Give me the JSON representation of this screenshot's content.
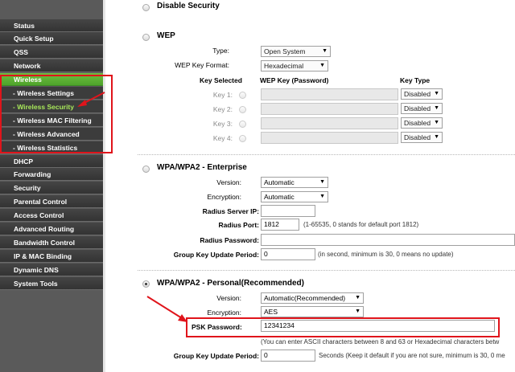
{
  "sidebar": {
    "items": [
      {
        "label": "Status"
      },
      {
        "label": "Quick Setup"
      },
      {
        "label": "QSS"
      },
      {
        "label": "Network"
      },
      {
        "label": "Wireless"
      },
      {
        "label": "- Wireless Settings"
      },
      {
        "label": "- Wireless Security"
      },
      {
        "label": "- Wireless MAC Filtering"
      },
      {
        "label": "- Wireless Advanced"
      },
      {
        "label": "- Wireless Statistics"
      },
      {
        "label": "DHCP"
      },
      {
        "label": "Forwarding"
      },
      {
        "label": "Security"
      },
      {
        "label": "Parental Control"
      },
      {
        "label": "Access Control"
      },
      {
        "label": "Advanced Routing"
      },
      {
        "label": "Bandwidth Control"
      },
      {
        "label": "IP & MAC Binding"
      },
      {
        "label": "Dynamic DNS"
      },
      {
        "label": "System Tools"
      }
    ]
  },
  "disable_security": {
    "label": "Disable Security"
  },
  "wep": {
    "title": "WEP",
    "type_label": "Type:",
    "type_value": "Open System",
    "format_label": "WEP Key Format:",
    "format_value": "Hexadecimal",
    "col_selected": "Key Selected",
    "col_key": "WEP Key (Password)",
    "col_type": "Key Type",
    "keys": [
      {
        "label": "Key 1:",
        "type": "Disabled"
      },
      {
        "label": "Key 2:",
        "type": "Disabled"
      },
      {
        "label": "Key 3:",
        "type": "Disabled"
      },
      {
        "label": "Key 4:",
        "type": "Disabled"
      }
    ]
  },
  "enterprise": {
    "title": "WPA/WPA2 - Enterprise",
    "version_label": "Version:",
    "version_value": "Automatic",
    "encryption_label": "Encryption:",
    "encryption_value": "Automatic",
    "radius_ip_label": "Radius Server IP:",
    "radius_ip_value": "",
    "radius_port_label": "Radius Port:",
    "radius_port_value": "1812",
    "radius_port_hint": "(1-65535, 0 stands for default port 1812)",
    "radius_pw_label": "Radius Password:",
    "radius_pw_value": "",
    "gkup_label": "Group Key Update Period:",
    "gkup_value": "0",
    "gkup_hint": "(in second, minimum is 30, 0 means no update)"
  },
  "personal": {
    "title": "WPA/WPA2 - Personal(Recommended)",
    "version_label": "Version:",
    "version_value": "Automatic(Recommended)",
    "encryption_label": "Encryption:",
    "encryption_value": "AES",
    "psk_label": "PSK Password:",
    "psk_value": "12341234",
    "psk_hint": "(You can enter ASCII characters between 8 and 63 or Hexadecimal characters betw",
    "gkup_label": "Group Key Update Period:",
    "gkup_value": "0",
    "gkup_hint": "Seconds (Keep it default if you are not sure, minimum is 30, 0 me"
  },
  "colors": {
    "accent_green": "#5cb234",
    "highlight": "#e0141b",
    "selected_text": "#a8e85a"
  }
}
